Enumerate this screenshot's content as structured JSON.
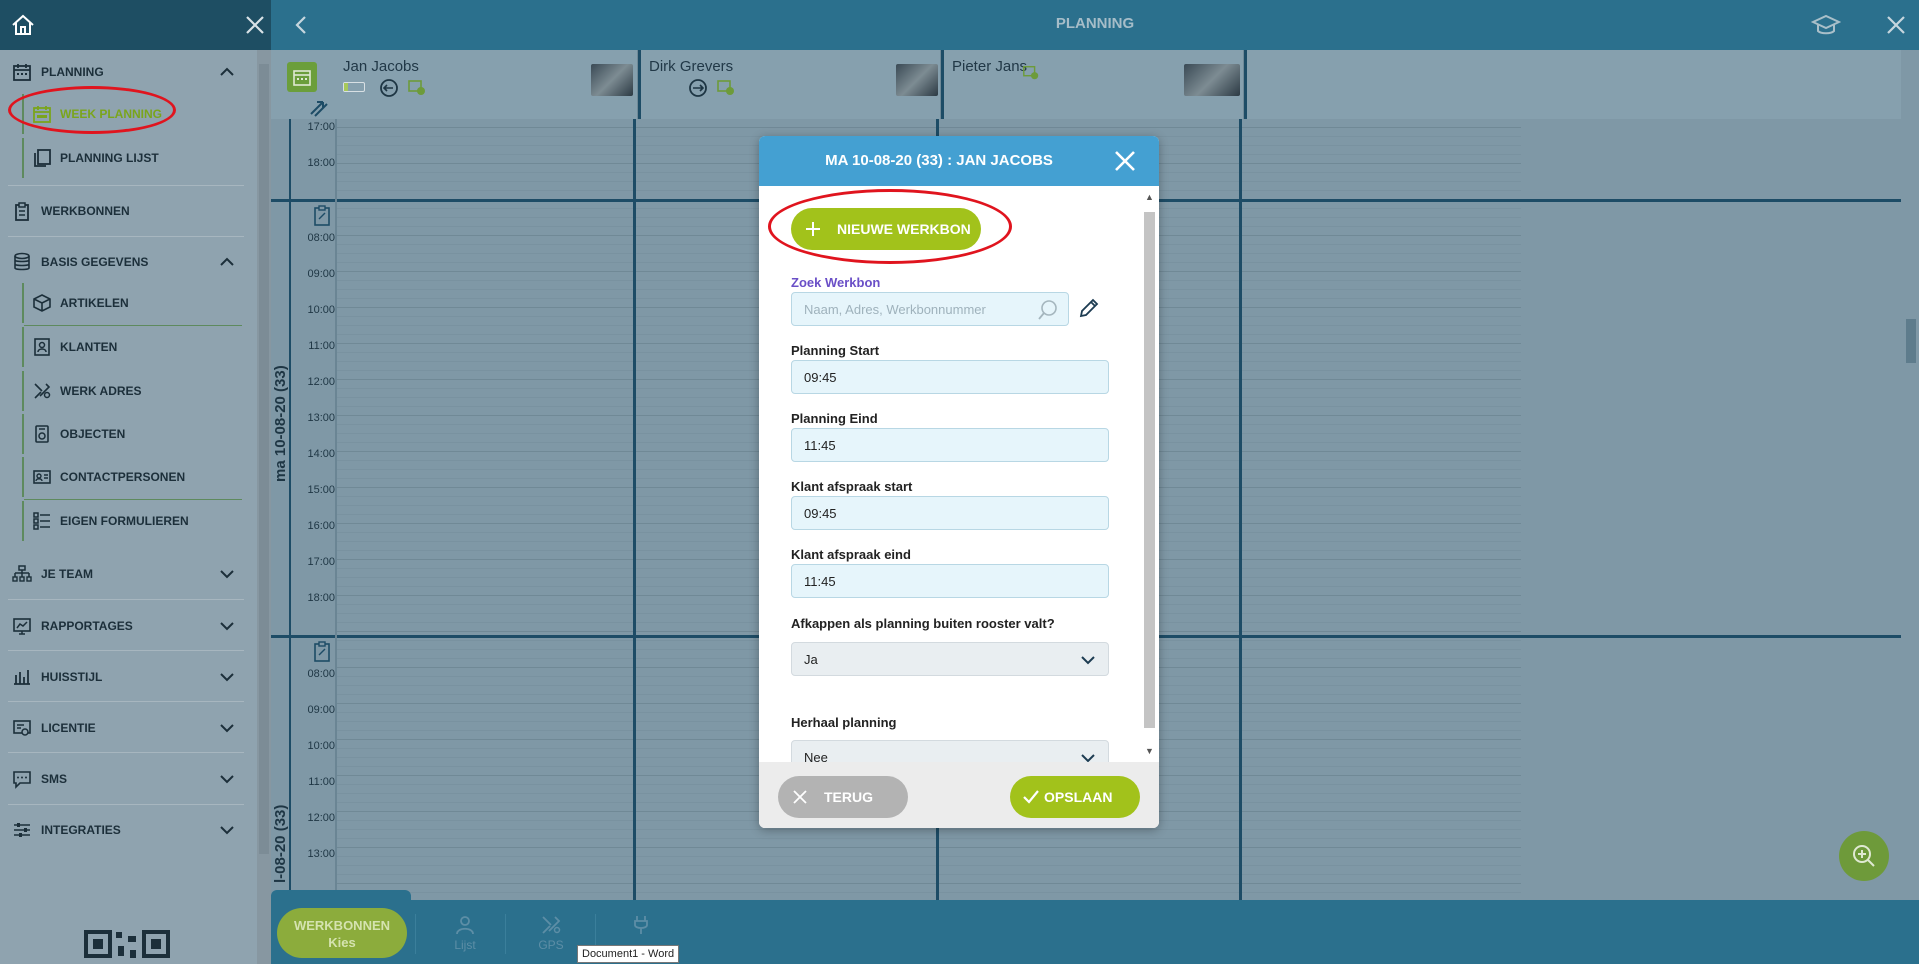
{
  "topbar": {
    "title": "PLANNING"
  },
  "sidebar": {
    "planning": "PLANNING",
    "week_planning": "WEEK PLANNING",
    "planning_lijst": "PLANNING LIJST",
    "werkbonnen": "WERKBONNEN",
    "basis_gegevens": "BASIS GEGEVENS",
    "artikelen": "ARTIKELEN",
    "klanten": "KLANTEN",
    "werk_adres": "WERK ADRES",
    "objecten": "OBJECTEN",
    "contactpersonen": "CONTACTPERSONEN",
    "eigen_formulieren": "EIGEN FORMULIEREN",
    "je_team": "JE TEAM",
    "rapportages": "RAPPORTAGES",
    "huisstijl": "HUISSTIJL",
    "licentie": "LICENTIE",
    "sms": "SMS",
    "integraties": "INTEGRATIES"
  },
  "employees": [
    {
      "name": "Jan Jacobs"
    },
    {
      "name": "Dirk Grevers"
    },
    {
      "name": "Pieter Jans"
    }
  ],
  "calendar": {
    "day1_label": "ma 10-08-20 (33)",
    "day2_label": "l-08-20 (33)",
    "times_top": [
      "17:00",
      "18:00"
    ],
    "times_day1": [
      "08:00",
      "09:00",
      "10:00",
      "11:00",
      "12:00",
      "13:00",
      "14:00",
      "15:00",
      "16:00",
      "17:00",
      "18:00"
    ],
    "times_day2": [
      "08:00",
      "09:00",
      "10:00",
      "11:00",
      "12:00",
      "13:00"
    ]
  },
  "modal": {
    "title": "MA 10-08-20 (33) : JAN JACOBS",
    "new_button": "NIEUWE WERKBON",
    "search_label": "Zoek Werkbon",
    "search_placeholder": "Naam, Adres, Werkbonnummer",
    "planning_start_label": "Planning Start",
    "planning_start_value": "09:45",
    "planning_end_label": "Planning Eind",
    "planning_end_value": "11:45",
    "client_start_label": "Klant afspraak start",
    "client_start_value": "09:45",
    "client_end_label": "Klant afspraak eind",
    "client_end_value": "11:45",
    "cutoff_label": "Afkappen als planning buiten rooster valt?",
    "cutoff_value": "Ja",
    "repeat_label": "Herhaal planning",
    "repeat_value": "Nee",
    "back_button": "TERUG",
    "save_button": "OPSLAAN"
  },
  "bottombar": {
    "werkbonnen_line1": "WERKBONNEN",
    "werkbonnen_line2": "Kies",
    "lijst": "Lijst",
    "gps": "GPS",
    "tooltip": "Document1 - Word"
  }
}
